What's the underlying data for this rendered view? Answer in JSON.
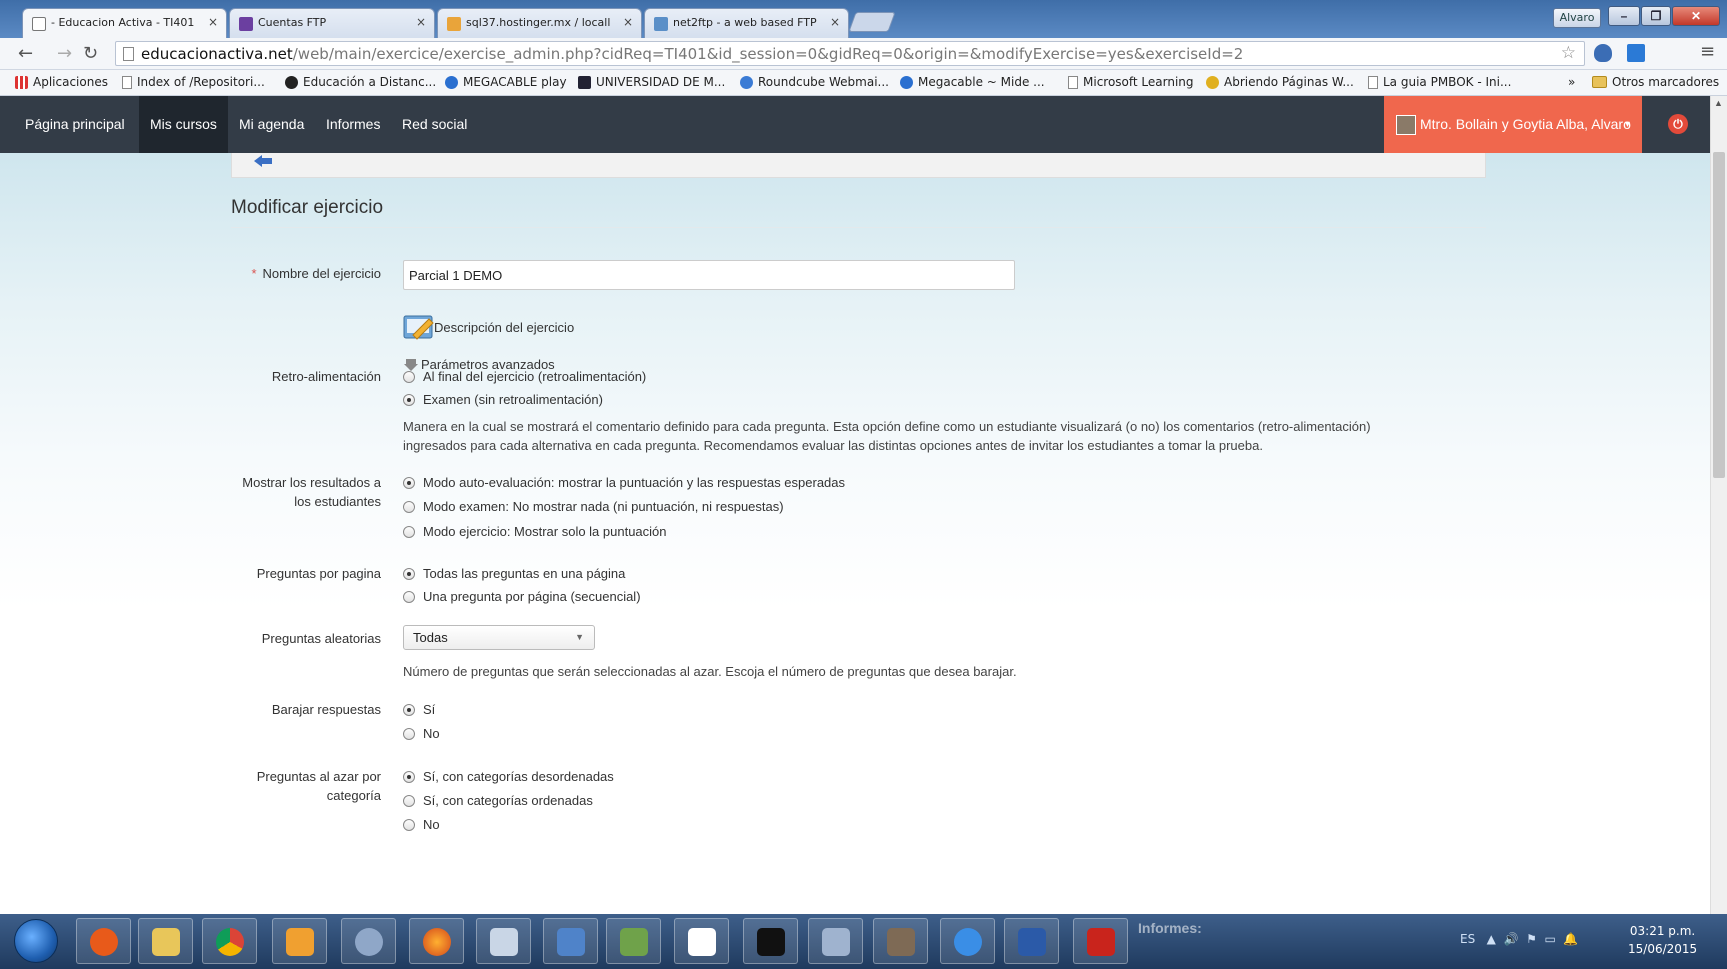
{
  "browser": {
    "tabs": [
      {
        "label": "- Educacion Activa - TI401",
        "active": true
      },
      {
        "label": "Cuentas FTP",
        "active": false
      },
      {
        "label": "sql37.hostinger.mx / locall",
        "active": false
      },
      {
        "label": "net2ftp - a web based FTP",
        "active": false
      }
    ],
    "user_button": "Alvaro",
    "url_host": "educacionactiva.net",
    "url_path": "/web/main/exercice/exercise_admin.php?cidReq=TI401&id_session=0&gidReq=0&origin=&modifyExercise=yes&exerciseId=2",
    "bookmarks": [
      "Aplicaciones",
      "Index of /Repositori...",
      "Educación a Distanc...",
      "MEGACABLE play",
      "UNIVERSIDAD DE M...",
      "Roundcube Webmai...",
      "Megacable ~ Mide ...",
      "Microsoft Learning",
      "Abriendo Páginas W...",
      "La guia PMBOK - Ini..."
    ],
    "bookmarks_more": "»",
    "other_bookmarks": "Otros marcadores"
  },
  "nav": {
    "items": [
      "Página principal",
      "Mis cursos",
      "Mi agenda",
      "Informes",
      "Red social"
    ],
    "user": "Mtro. Bollain y Goytia Alba, Alvaro",
    "caret": "▾"
  },
  "page": {
    "title": "Modificar ejercicio",
    "name_label": "Nombre del ejercicio",
    "required_mark": "*",
    "name_value": "Parcial 1 DEMO",
    "description_link": "Descripción del ejercicio",
    "advanced_link": "Parámetros avanzados",
    "feedback": {
      "label": "Retro-alimentación",
      "options": [
        "Al final del ejercicio (retroalimentación)",
        "Examen (sin retroalimentación)"
      ],
      "help_1": "Manera en la cual se mostrará el comentario definido para cada pregunta. Esta opción define como un estudiante visualizará (o no) los comentarios (retro-alimentación)",
      "help_2": "ingresados para cada alternativa en cada pregunta. Recomendamos evaluar las distintas opciones antes de invitar los estudiantes a tomar la prueba."
    },
    "results": {
      "label_1": "Mostrar los resultados a",
      "label_2": "los estudiantes",
      "options": [
        "Modo auto-evaluación: mostrar la puntuación y las respuestas esperadas",
        "Modo examen: No mostrar nada (ni puntuación, ni respuestas)",
        "Modo ejercicio: Mostrar solo la puntuación"
      ]
    },
    "per_page": {
      "label": "Preguntas por pagina",
      "options": [
        "Todas las preguntas en una página",
        "Una pregunta por página (secuencial)"
      ]
    },
    "random": {
      "label": "Preguntas aleatorias",
      "selected": "Todas",
      "help": "Número de preguntas que serán seleccionadas al azar. Escoja el número de preguntas que desea barajar."
    },
    "shuffle": {
      "label": "Barajar respuestas",
      "options": [
        "Sí",
        "No"
      ]
    },
    "by_category": {
      "label_1": "Preguntas al azar por",
      "label_2": "categoría",
      "options": [
        "Sí, con categorías desordenadas",
        "Sí, con categorías ordenadas",
        "No"
      ]
    }
  },
  "taskbar": {
    "tray_lang": "ES",
    "time": "03:21 p.m.",
    "date": "15/06/2015",
    "ghost_text": "Informes:"
  }
}
